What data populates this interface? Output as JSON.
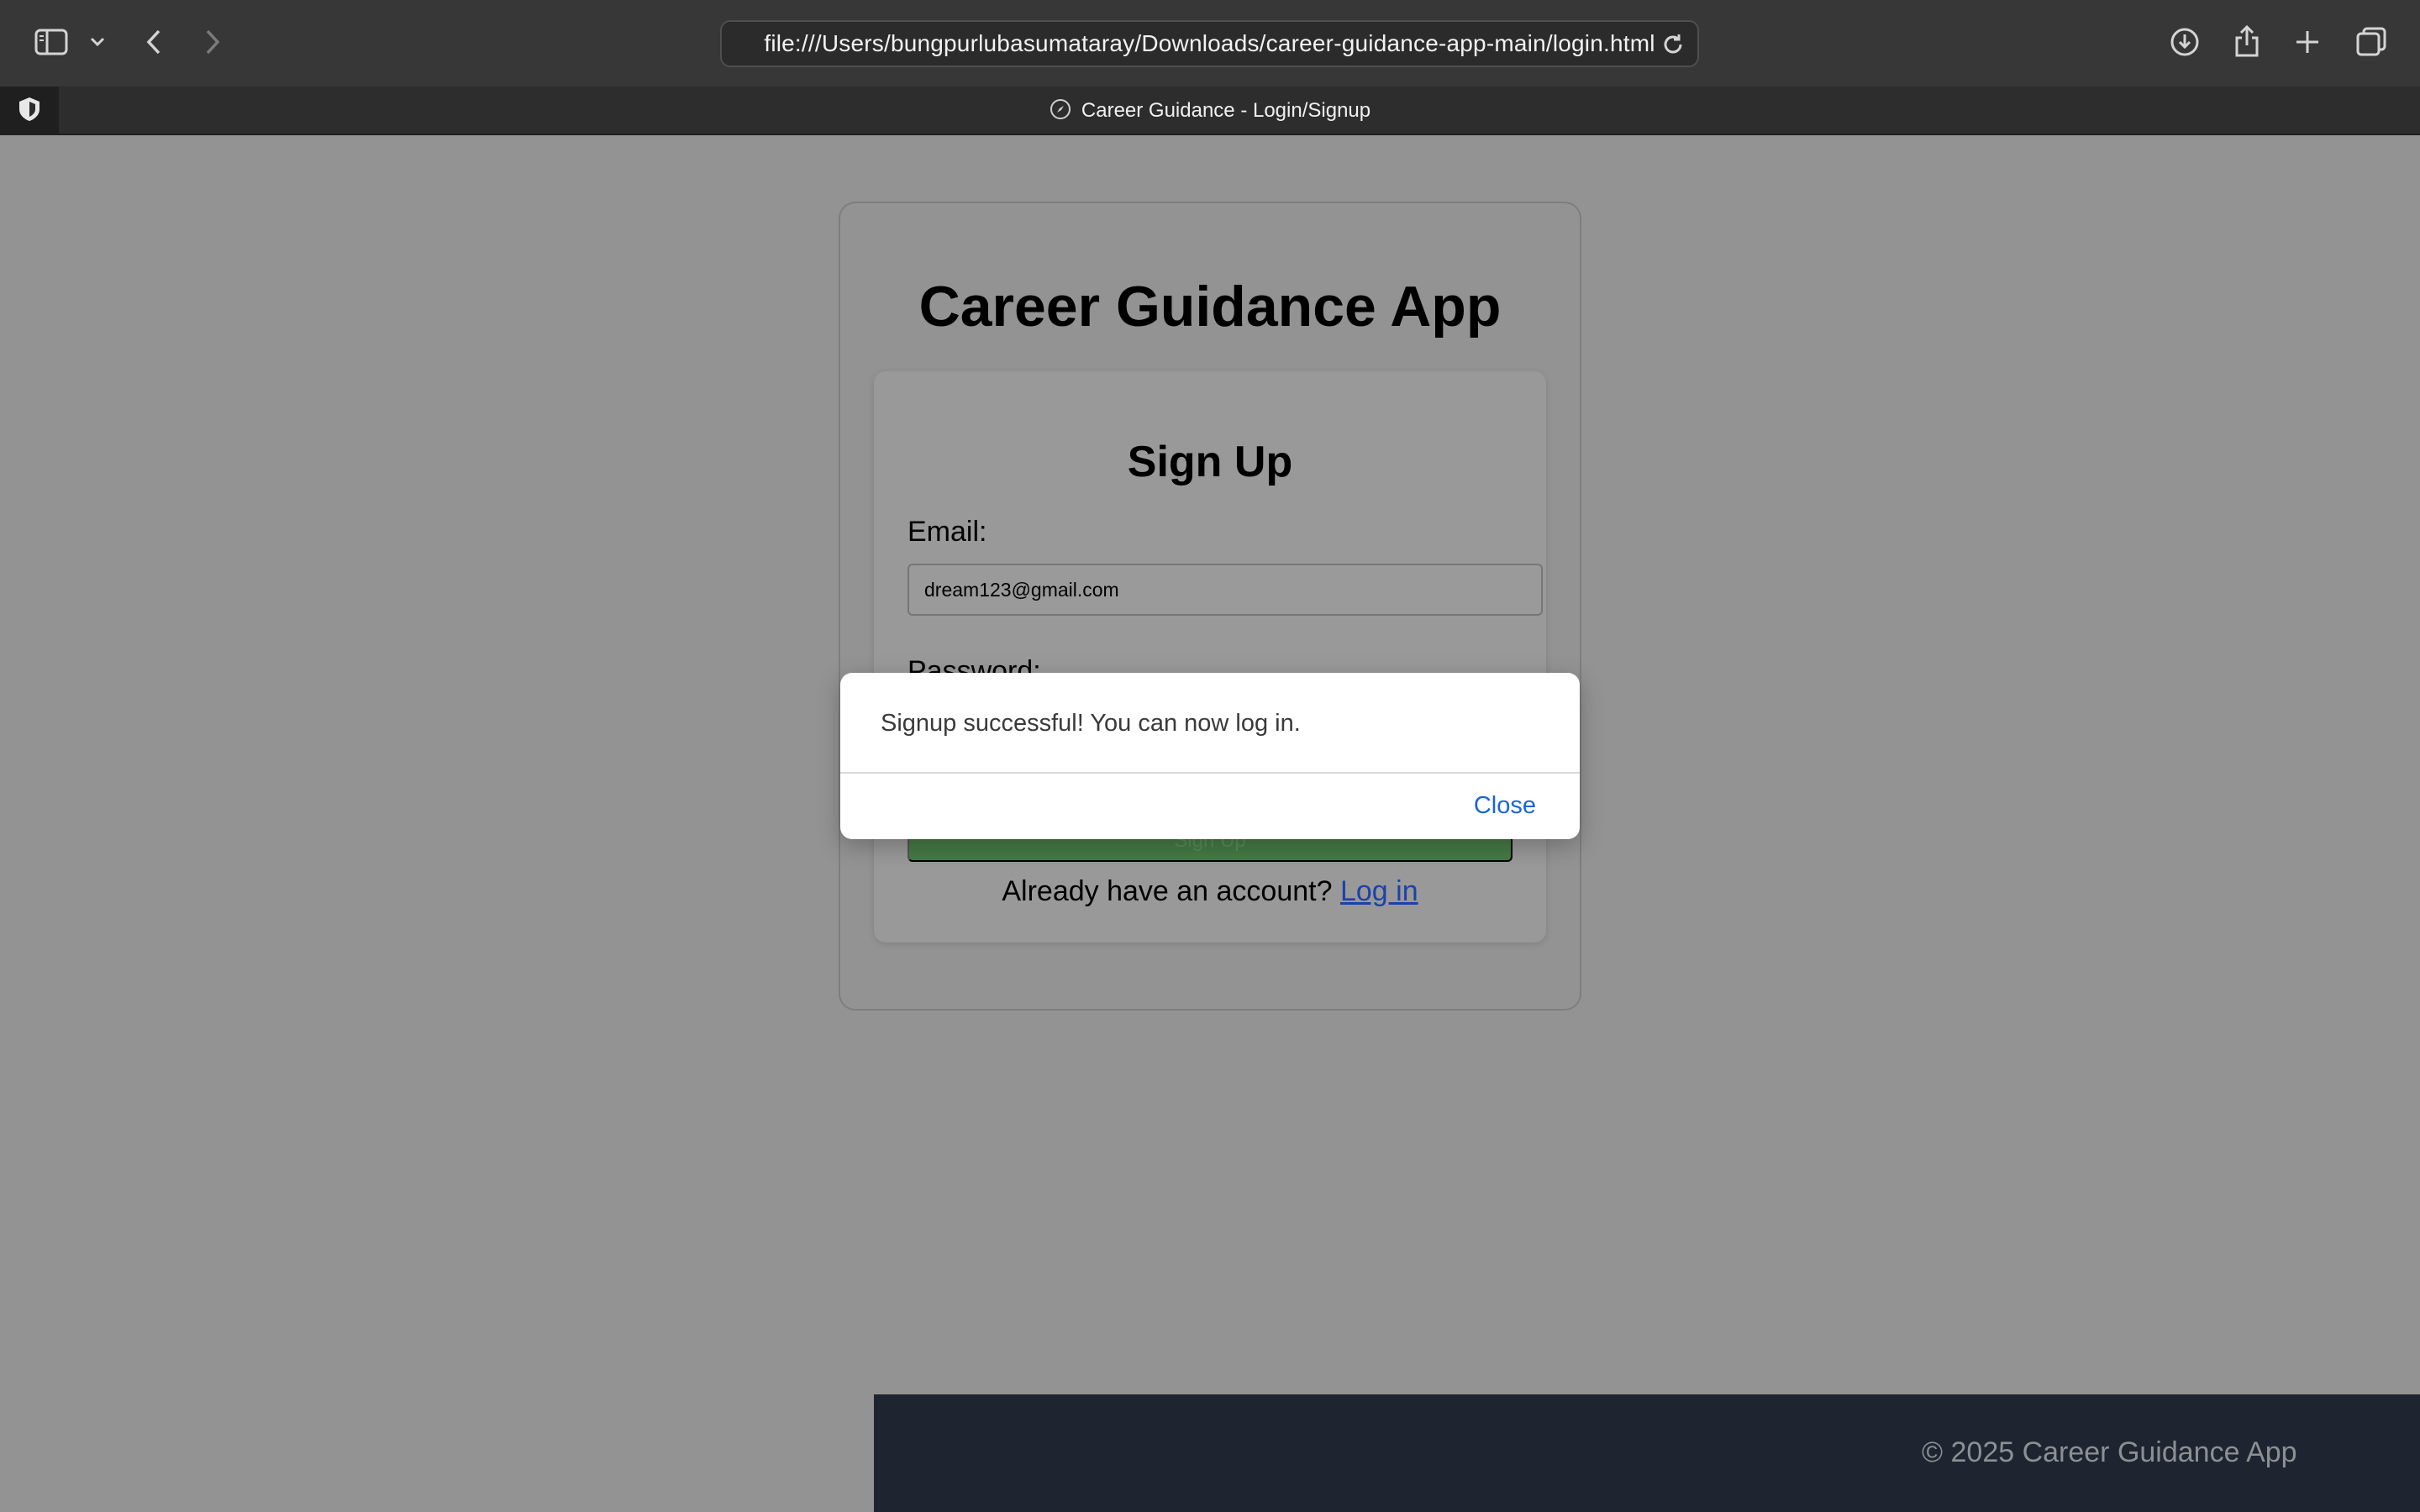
{
  "browser": {
    "url": "file:///Users/bungpurlubasumataray/Downloads/career-guidance-app-main/login.html",
    "tab_title": "Career Guidance - Login/Signup",
    "icons": [
      "sidebar-icon",
      "chevron-down-icon",
      "back-arrow-icon",
      "forward-arrow-icon",
      "reload-icon",
      "download-icon",
      "share-icon",
      "plus-icon",
      "tabs-overview-icon",
      "compass-icon",
      "shield-icon"
    ]
  },
  "page": {
    "app_title": "Career Guidance App",
    "form": {
      "title": "Sign Up",
      "email_label": "Email:",
      "email_value": "dream123@gmail.com",
      "password_label": "Password:",
      "submit_label": "Sign Up",
      "switch_prompt": "Already have an account?",
      "switch_link": "Log in"
    },
    "footer": "© 2025 Career Guidance App"
  },
  "dialog": {
    "message": "Signup successful! You can now log in.",
    "close_label": "Close"
  },
  "colors": {
    "toolbar": "#373737",
    "page_overlay": "#939393",
    "submit_button": "#467a45",
    "link": "#1a43a8",
    "footer": "#1e2530",
    "dialog_button": "#1a66d2"
  }
}
